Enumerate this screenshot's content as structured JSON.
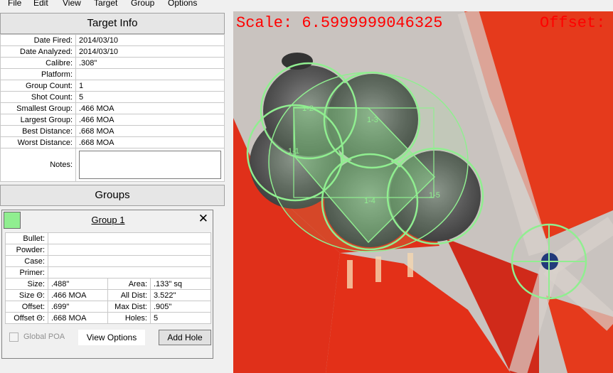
{
  "menu": [
    "File",
    "Edit",
    "View",
    "Target",
    "Group",
    "Options"
  ],
  "target_info": {
    "title": "Target Info",
    "rows": [
      {
        "label": "Date Fired:",
        "value": "2014/03/10"
      },
      {
        "label": "Date Analyzed:",
        "value": "2014/03/10"
      },
      {
        "label": "Calibre:",
        "value": ".308\""
      },
      {
        "label": "Platform:",
        "value": ""
      },
      {
        "label": "Group Count:",
        "value": "1"
      },
      {
        "label": "Shot Count:",
        "value": "5"
      },
      {
        "label": "Smallest Group:",
        "value": ".466 MOA"
      },
      {
        "label": "Largest Group:",
        "value": ".466 MOA"
      },
      {
        "label": "Best Distance:",
        "value": ".668 MOA"
      },
      {
        "label": "Worst Distance:",
        "value": ".668 MOA"
      }
    ],
    "notes_label": "Notes:",
    "notes_value": ""
  },
  "groups": {
    "title": "Groups",
    "group": {
      "color": "#90ee90",
      "name": "Group 1",
      "close_icon": "close-icon",
      "bullet_label": "Bullet:",
      "bullet": "",
      "powder_label": "Powder:",
      "powder": "",
      "case_label": "Case:",
      "case": "",
      "primer_label": "Primer:",
      "primer": "",
      "size_label": "Size:",
      "size": ".488\"",
      "area_label": "Area:",
      "area": ".133\" sq",
      "size_theta_label": "Size Θ:",
      "size_theta": ".466 MOA",
      "all_dist_label": "All Dist:",
      "all_dist": "3.522\"",
      "offset_label": "Offset:",
      "offset": ".699\"",
      "max_dist_label": "Max Dist:",
      "max_dist": ".905\"",
      "offset_theta_label": "Offset Θ:",
      "offset_theta": ".668 MOA",
      "holes_label": "Holes:",
      "holes": "5",
      "global_poa_label": "Global POA",
      "global_poa_checked": false,
      "view_options_label": "View Options",
      "add_hole_label": "Add Hole"
    }
  },
  "target_view": {
    "scale_text": "Scale: 6.5999999046325",
    "offset_text": "Offset:",
    "overlay_color": "#90ee90",
    "text_color": "#ff0000",
    "holes": [
      "1-1",
      "1-2",
      "1-3",
      "1-4",
      "1-5"
    ]
  }
}
